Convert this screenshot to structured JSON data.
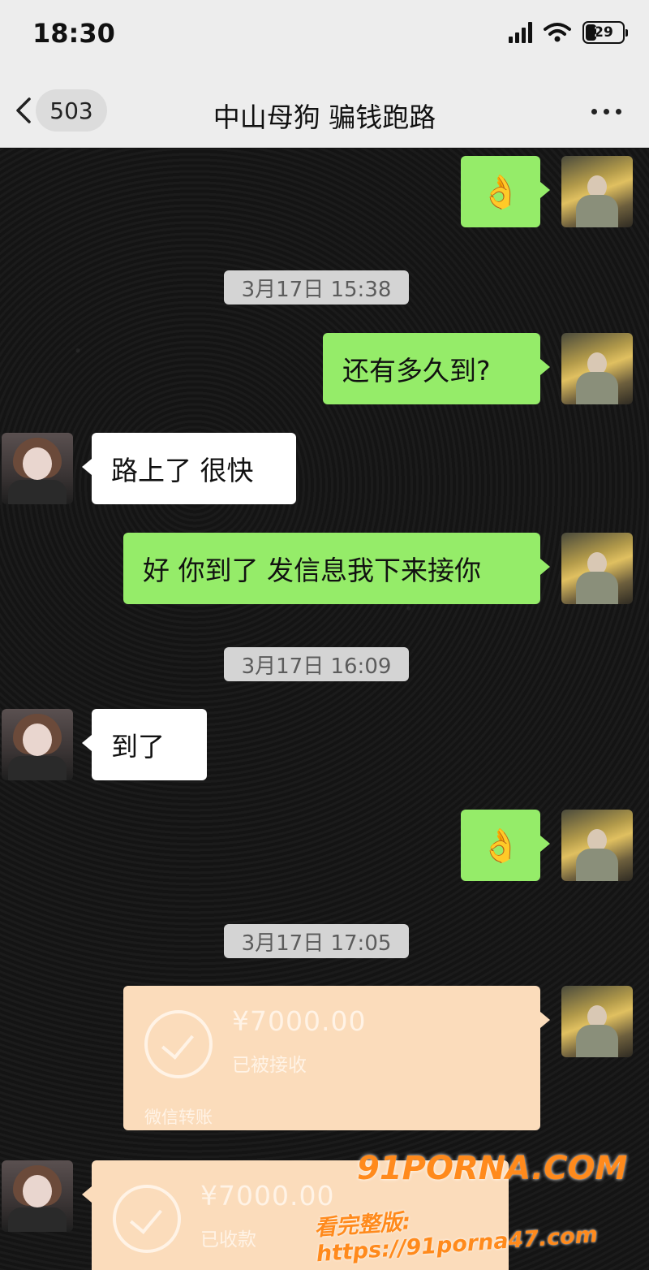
{
  "status_bar": {
    "time": "18:30",
    "battery": "29",
    "battery_pct": 0.29
  },
  "nav": {
    "back_count": "503",
    "title": "中山母狗 骗钱跑路"
  },
  "messages": [
    {
      "type": "sent",
      "text": "👌"
    },
    {
      "type": "timestamp",
      "text": "3月17日 15:38"
    },
    {
      "type": "sent",
      "text": "还有多久到?"
    },
    {
      "type": "received",
      "text": "路上了  很快"
    },
    {
      "type": "sent",
      "text": "好  你到了 发信息我下来接你"
    },
    {
      "type": "timestamp",
      "text": "3月17日 16:09"
    },
    {
      "type": "received",
      "text": "到了"
    },
    {
      "type": "sent",
      "text": "👌"
    },
    {
      "type": "timestamp",
      "text": "3月17日 17:05"
    },
    {
      "type": "transfer_sent",
      "amount": "¥7000.00",
      "status": "已被接收",
      "footer": "微信转账"
    },
    {
      "type": "transfer_received",
      "amount": "¥7000.00",
      "status": "已收款"
    }
  ],
  "watermark": {
    "brand": "91PORNA.COM",
    "url": "看完整版: https://91porna47.com"
  }
}
